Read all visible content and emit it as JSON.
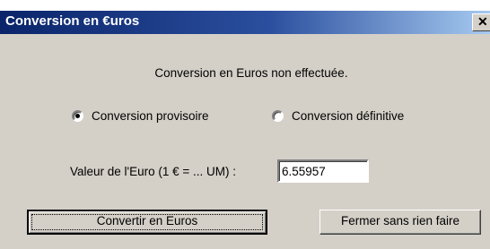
{
  "window": {
    "title": "Conversion en €uros",
    "close_glyph": "✕"
  },
  "message": "Conversion en Euros non effectuée.",
  "options": {
    "provisional_label": "Conversion provisoire",
    "provisional_selected": true,
    "definitive_label": "Conversion définitive",
    "definitive_selected": false
  },
  "euro_value": {
    "label": "Valeur de l'Euro (1 € = ... UM) :",
    "value": "6.55957"
  },
  "buttons": {
    "convert_label": "Convertir en Euros",
    "close_label": "Fermer sans rien faire"
  }
}
